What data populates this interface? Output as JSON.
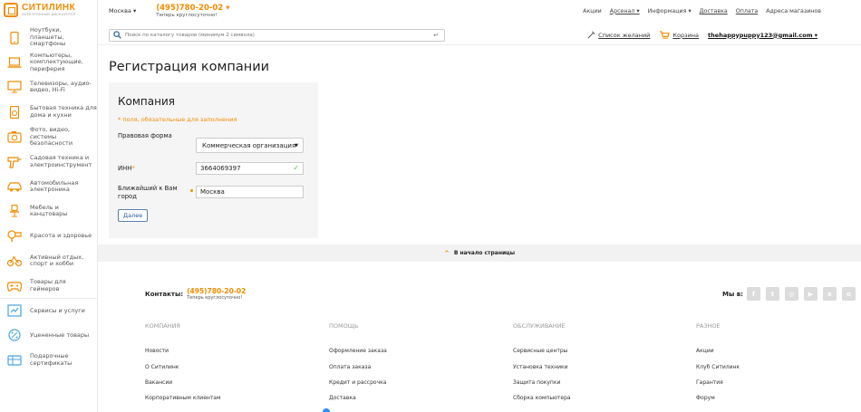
{
  "logo": {
    "name": "СИТИЛИНК",
    "tagline": "ЭЛЕКТРОННЫЙ ДИСКАУНТЕР"
  },
  "sidebar": {
    "items": [
      {
        "label": "Ноутбуки, планшеты, смартфоны",
        "icon": "phone-icon"
      },
      {
        "label": "Компьютеры, комплектующие, периферия",
        "icon": "laptop-icon"
      },
      {
        "label": "Телевизоры, аудио-видео, Hi-Fi",
        "icon": "tv-icon"
      },
      {
        "label": "Бытовая техника для дома и кухни",
        "icon": "fridge-icon"
      },
      {
        "label": "Фото, видео, системы безопасности",
        "icon": "camera-icon"
      },
      {
        "label": "Садовая техника и электроинструмент",
        "icon": "drill-icon"
      },
      {
        "label": "Автомобильная электроника",
        "icon": "car-icon"
      },
      {
        "label": "Мебель и канцтовары",
        "icon": "chair-icon"
      },
      {
        "label": "Красота и здоровье",
        "icon": "hairdryer-icon"
      },
      {
        "label": "Активный отдых, спорт и хобби",
        "icon": "bicycle-icon"
      },
      {
        "label": "Товары для геймеров",
        "icon": "gamepad-icon"
      },
      {
        "label": "Сервисы и услуги",
        "icon": "service-icon"
      },
      {
        "label": "Уцененные товары",
        "icon": "discount-icon"
      },
      {
        "label": "Подарочные сертификаты",
        "icon": "gift-card-icon"
      }
    ]
  },
  "header": {
    "city": "Москва",
    "phone": "(495)780-20-02",
    "phone_note": "Теперь круглосуточно!",
    "links": [
      "Акции",
      "Арсенал",
      "Информация",
      "Доставка",
      "Оплата",
      "Адреса магазинов"
    ]
  },
  "search": {
    "placeholder": "Поиск по каталогу товаров (минимум 2 символа)"
  },
  "user": {
    "wishlist": "Список желаний",
    "cart": "Корзина",
    "email": "thehappypuppy123@gmail.com"
  },
  "form": {
    "page_title": "Регистрация компании",
    "section_title": "Компания",
    "required_note": "* поля, обязательные для заполнения",
    "legal_form_label": "Правовая форма",
    "legal_form_value": "Коммерческая организация",
    "inn_label": "ИНН",
    "inn_value": "3664069397",
    "city_label": "Ближайший к Вам город",
    "city_value": "Москва",
    "next_button": "Далее"
  },
  "footer": {
    "back_to_top": "В начало страницы",
    "contacts_label": "Контакты:",
    "phone": "(495)780-20-02",
    "phone_note": "Теперь круглосуточно!",
    "social_label": "Мы в:",
    "columns": [
      {
        "title": "Компания",
        "links": [
          "Новости",
          "О Ситилинк",
          "Вакансии",
          "Корпоративным клиентам"
        ]
      },
      {
        "title": "Помощь",
        "links": [
          "Оформление заказа",
          "Оплата заказа",
          "Кредит и рассрочка",
          "Доставка"
        ]
      },
      {
        "title": "Обслуживание",
        "links": [
          "Сервисные центры",
          "Установка техники",
          "Защита покупки",
          "Сборка компьютера"
        ]
      },
      {
        "title": "Разное",
        "links": [
          "Акции",
          "Клуб Ситилинк",
          "Гарантия",
          "Форум"
        ]
      }
    ]
  },
  "colors": {
    "accent": "#f28b00",
    "link_blue": "#2a5a9b",
    "panel_bg": "#f5f5f5",
    "valid_green": "#5cb85c"
  }
}
